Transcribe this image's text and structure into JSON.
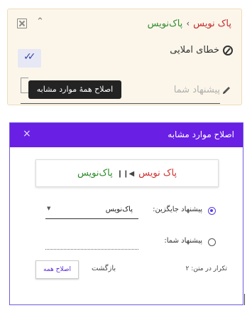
{
  "card": {
    "crumb_word1": "پاک نویس",
    "crumb_sep": "›",
    "crumb_word2": "پاک‌نویس",
    "error_type": "خطای املایی",
    "suggestion_placeholder": "پیشنهاد شما",
    "tooltip": "اصلاح همهٔ موارد مشابه"
  },
  "modal": {
    "title": "اصلاح موارد مشابه",
    "close": "×",
    "preview_old": "پاک نویس",
    "preview_arrow": "◀❙❙",
    "preview_new": "پاک‌نویس",
    "option_replace_label": "پیشنهاد جایگزین:",
    "option_replace_value": "پاک‌نویس",
    "option_yours_label": "پیشنهاد شما:",
    "count_label": "تکرار در متن:  ۲",
    "back": "بازگشت",
    "fix_all": "اصلاح همه"
  },
  "colors": {
    "header": "#6a1fe5",
    "accent": "#5a3de0",
    "wrong_word": "#c62828",
    "correct_word": "#2e8b2e",
    "card_bg": "#fcf6ea"
  }
}
